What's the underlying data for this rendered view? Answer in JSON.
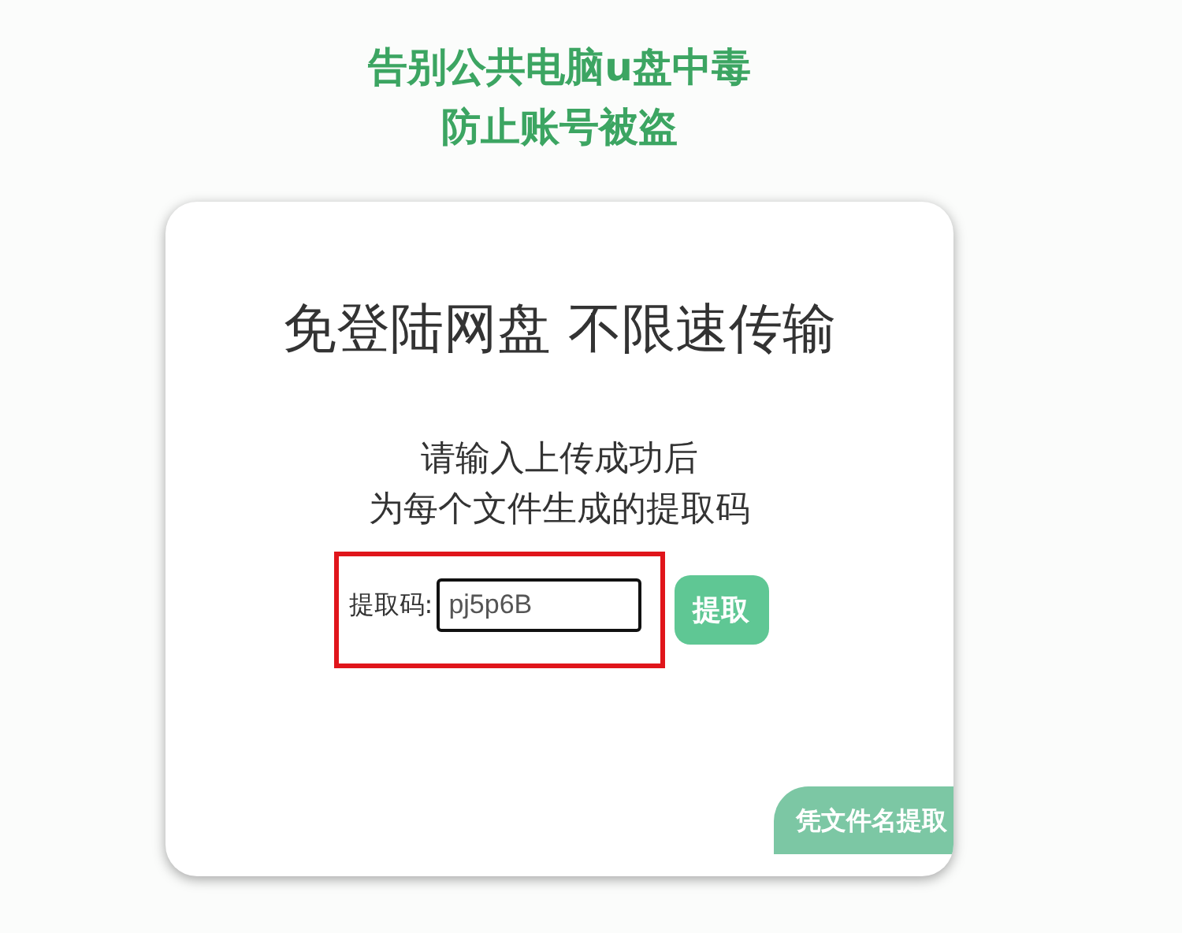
{
  "header": {
    "lines": [
      "告别公共电脑u盘中毒",
      "防止账号被盗"
    ]
  },
  "card": {
    "title": "免登陆网盘 不限速传输",
    "instructions": [
      "请输入上传成功后",
      "为每个文件生成的提取码"
    ],
    "code_field": {
      "label": "提取码:",
      "value": "pj5p6B",
      "highlighted": true
    },
    "extract_button": "提取",
    "filename_button": "凭文件名提取"
  }
}
